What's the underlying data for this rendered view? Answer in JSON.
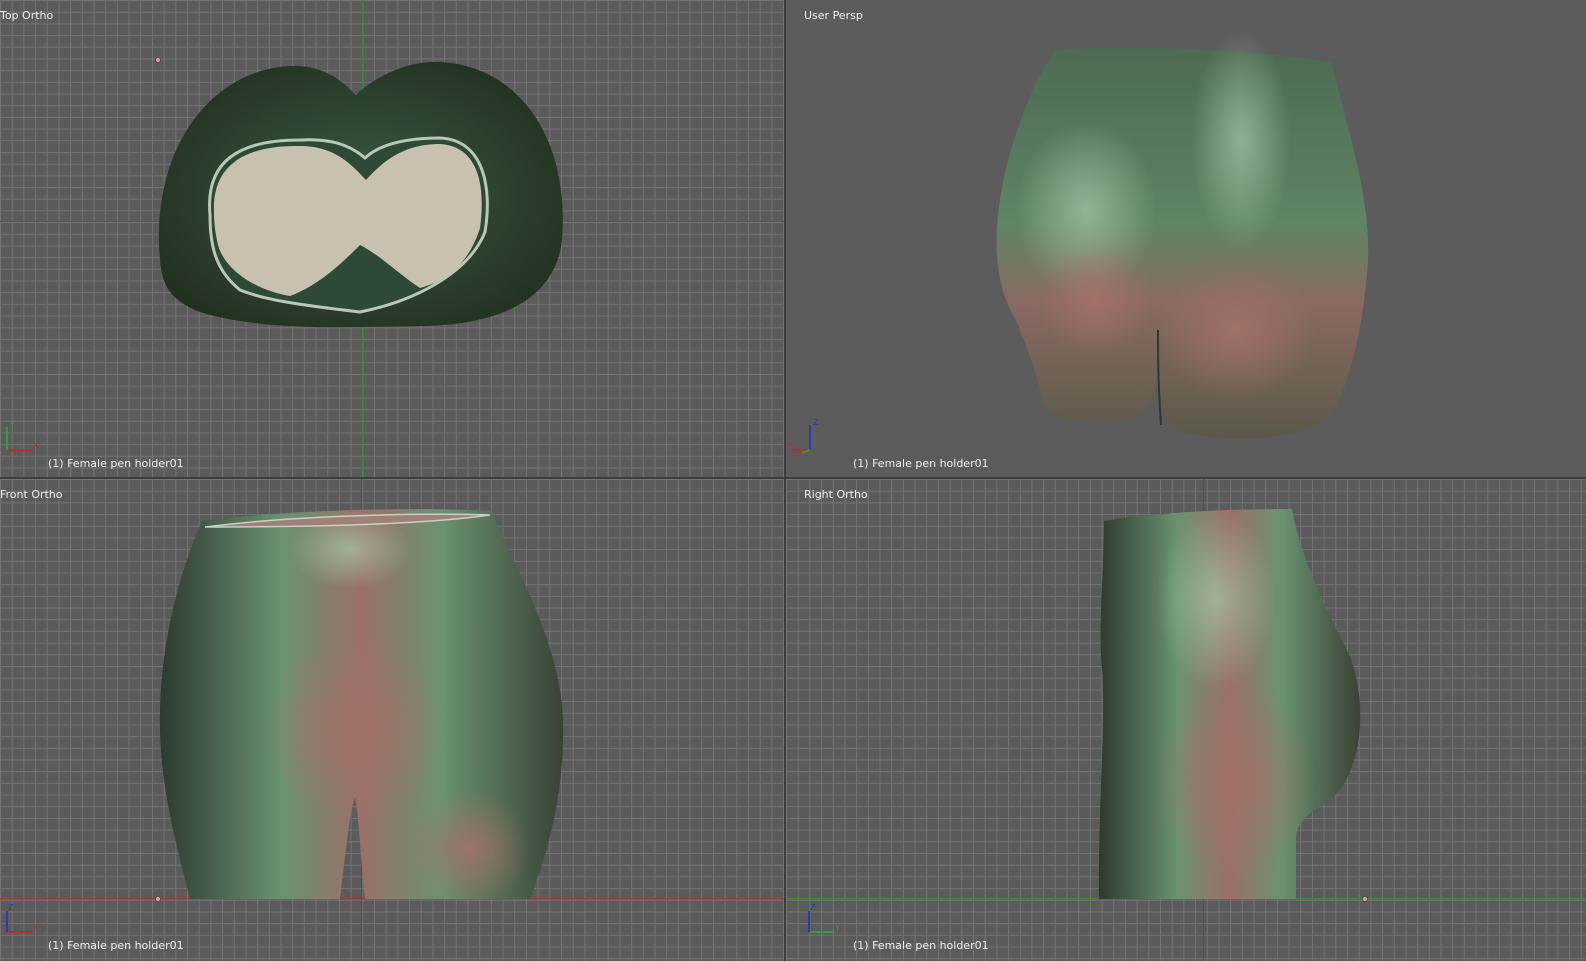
{
  "viewports": [
    {
      "id": "top",
      "title": "Top Ortho",
      "status": "(1) Female pen holder01",
      "gizmo": [
        "Y",
        "X"
      ]
    },
    {
      "id": "persp",
      "title": "User Persp",
      "status": "(1) Female pen holder01",
      "gizmo": [
        "Z",
        "X"
      ]
    },
    {
      "id": "front",
      "title": "Front Ortho",
      "status": "(1) Female pen holder01",
      "gizmo": [
        "Z",
        "X"
      ]
    },
    {
      "id": "right",
      "title": "Right Ortho",
      "status": "(1) Female pen holder01",
      "gizmo": [
        "Z",
        "Y"
      ]
    }
  ],
  "colors": {
    "x_axis": "#b03030",
    "y_axis": "#3a9a3a",
    "z_axis": "#2a3ab0",
    "mesh_green": "#4f6e55",
    "mesh_pink": "#9a6a62"
  }
}
